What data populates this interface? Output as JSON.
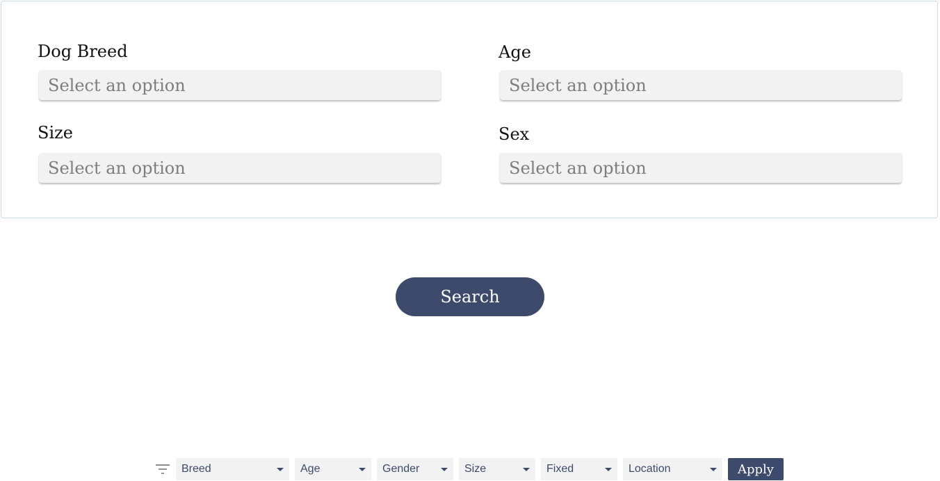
{
  "form": {
    "breed": {
      "label": "Dog Breed",
      "placeholder": "Select an option"
    },
    "age": {
      "label": "Age",
      "placeholder": "Select an option"
    },
    "size": {
      "label": "Size",
      "placeholder": "Select an option"
    },
    "sex": {
      "label": "Sex",
      "placeholder": "Select an option"
    }
  },
  "search_button": "Search",
  "filter_bar": {
    "icon": "filter-icon",
    "filters": [
      "Breed",
      "Age",
      "Gender",
      "Size",
      "Fixed",
      "Location"
    ],
    "apply_label": "Apply"
  },
  "colors": {
    "accent": "#3d4a6b",
    "select_bg": "#f2f2f2",
    "panel_border": "#c9d7e6",
    "placeholder": "#7d7d7d"
  }
}
